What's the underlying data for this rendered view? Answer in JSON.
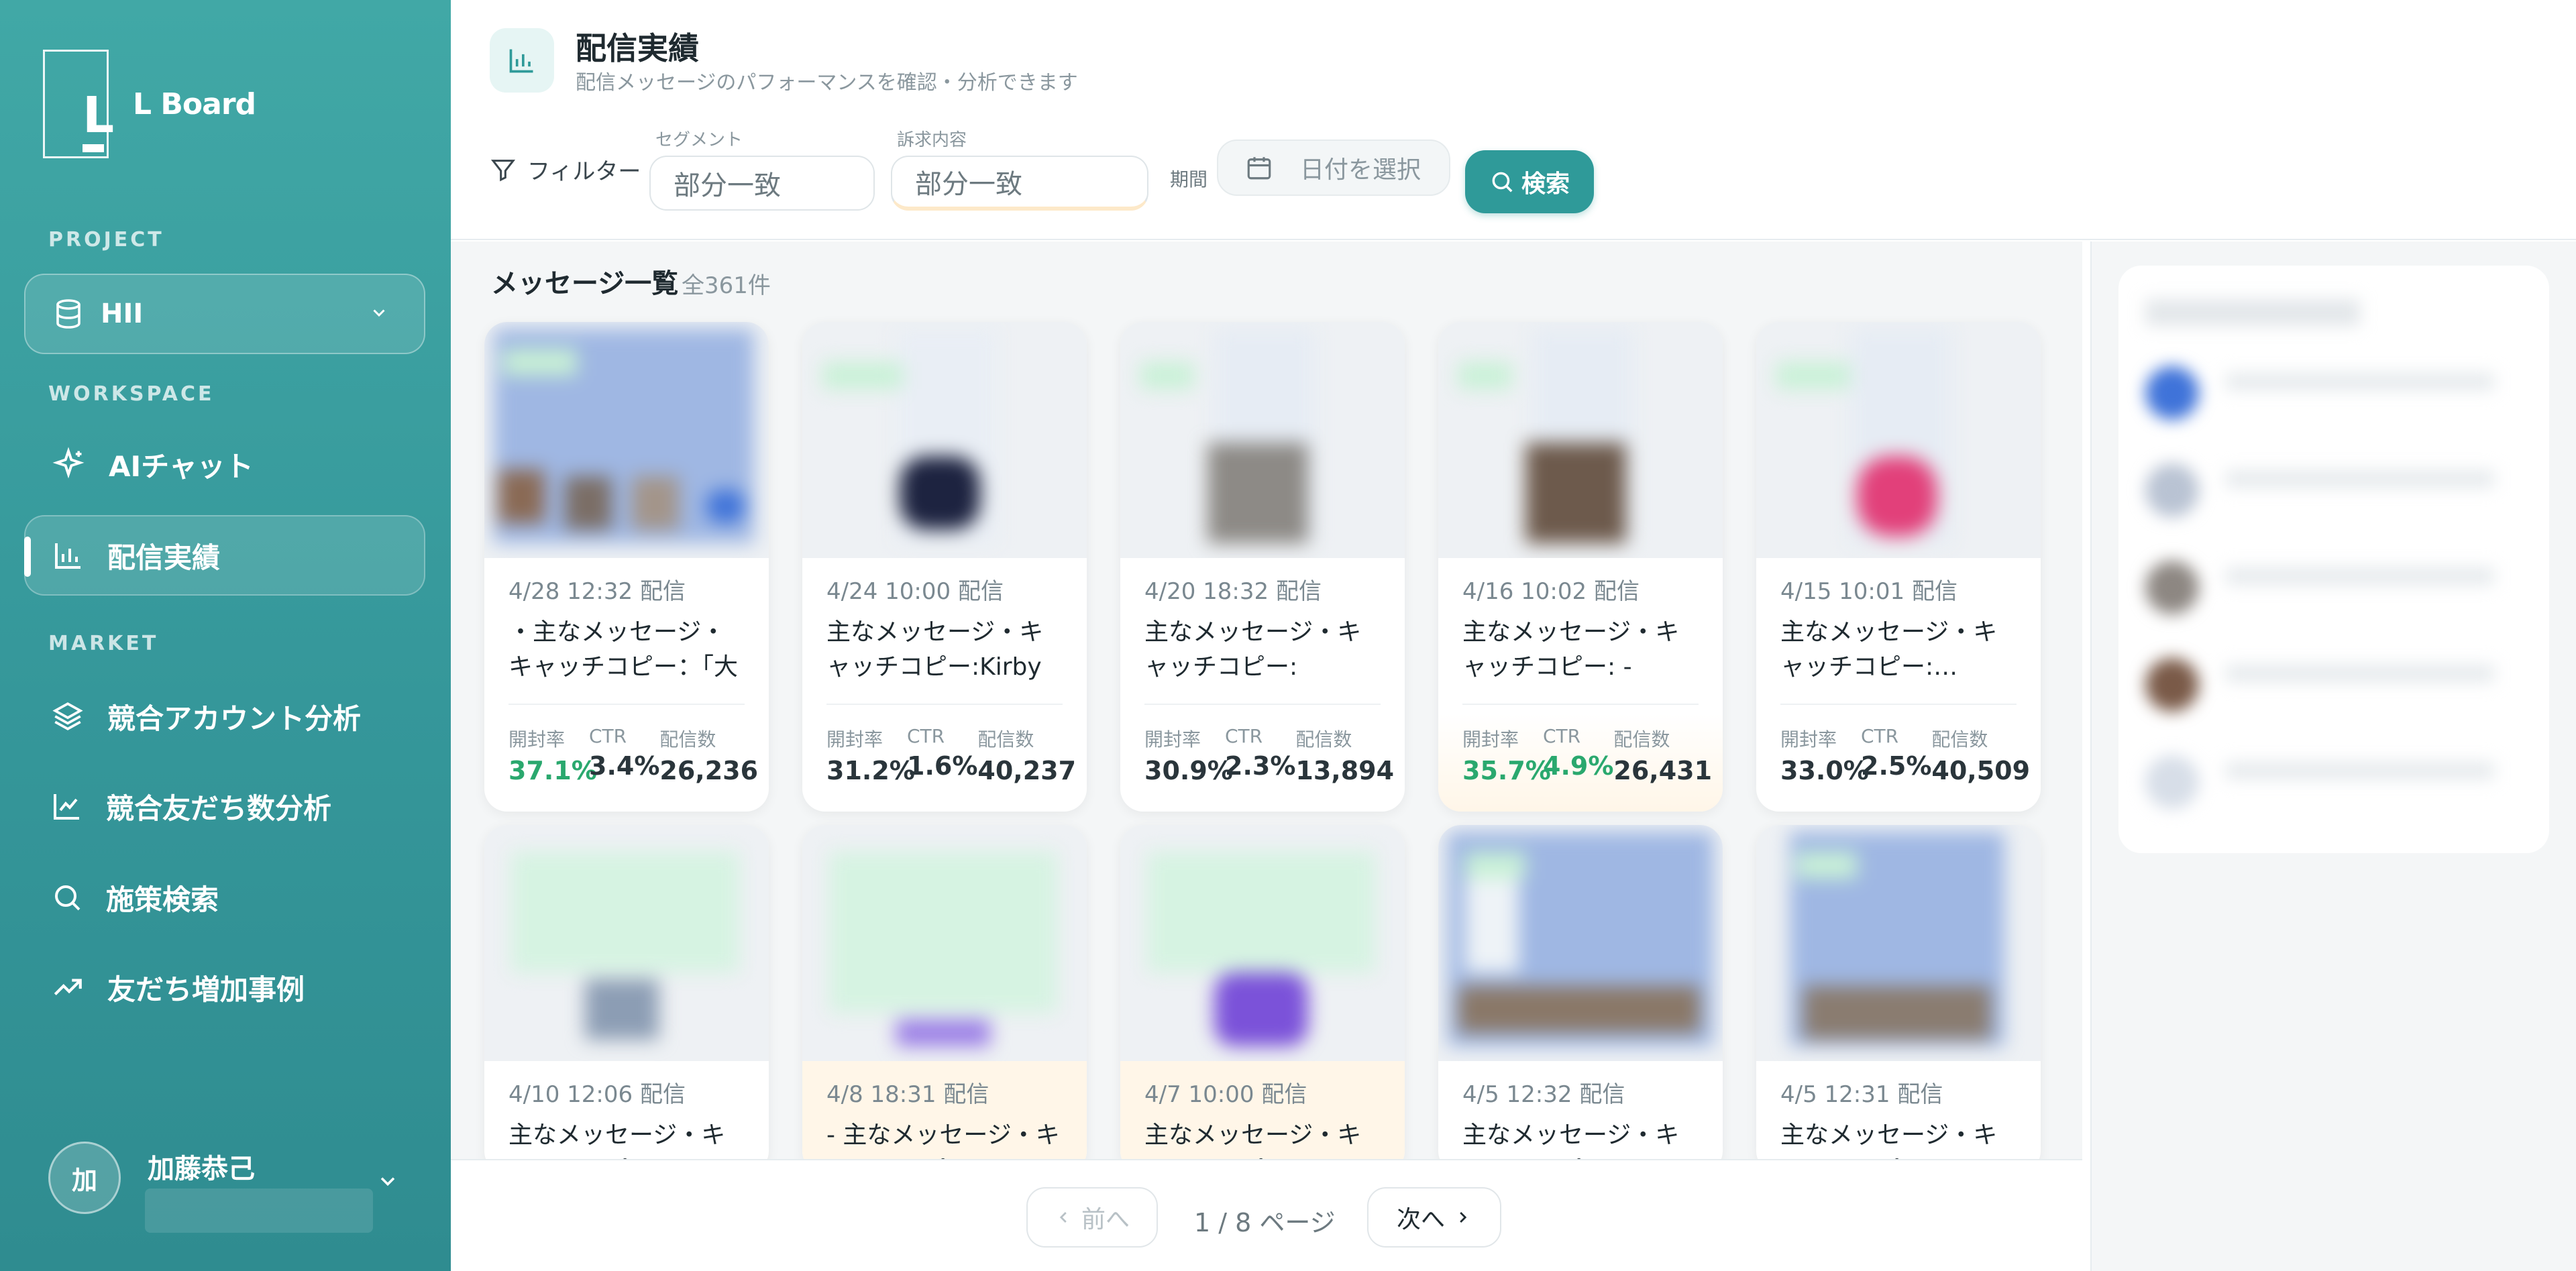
{
  "brand": {
    "name": "L Board"
  },
  "sidebar": {
    "project_label": "PROJECT",
    "project_name": "HII",
    "workspace_label": "WORKSPACE",
    "market_label": "MARKET",
    "items": [
      {
        "label": "AIチャット",
        "icon": "sparkle-icon"
      },
      {
        "label": "配信実績",
        "icon": "bar-chart-icon",
        "active": true
      },
      {
        "label": "競合アカウント分析",
        "icon": "layers-icon"
      },
      {
        "label": "競合友だち数分析",
        "icon": "line-chart-icon"
      },
      {
        "label": "施策検索",
        "icon": "search-icon"
      },
      {
        "label": "友だち増加事例",
        "icon": "trend-up-icon"
      }
    ],
    "user": {
      "initial": "加",
      "name": "加藤恭己"
    }
  },
  "header": {
    "title": "配信実績",
    "subtitle": "配信メッセージのパフォーマンスを確認・分析できます",
    "filter_label": "フィルター",
    "segment_label": "セグメント",
    "segment_value": "部分一致",
    "appeal_label": "訴求内容",
    "appeal_value": "部分一致",
    "period_label": "期間",
    "date_placeholder": "日付を選択",
    "search_label": "検索"
  },
  "list": {
    "title": "メッセージ一覧",
    "count": "全361件",
    "metric_labels": {
      "open": "開封率",
      "ctr": "CTR",
      "sent": "配信数"
    },
    "cards": [
      {
        "date": "4/28 12:32 配信",
        "copy": "・主なメッセージ・キャッチコピー：「大人…",
        "open": "37.1%",
        "ctr": "3.4%",
        "sent": "26,236"
      },
      {
        "date": "4/24 10:00 配信",
        "copy": "主なメッセージ・キャッチコピー:Kirby …",
        "open": "31.2%",
        "ctr": "1.6%",
        "sent": "40,237"
      },
      {
        "date": "4/20 18:32 配信",
        "copy": "主なメッセージ・キャッチコピー: Men'…",
        "open": "30.9%",
        "ctr": "2.3%",
        "sent": "13,894"
      },
      {
        "date": "4/16 10:02 配信",
        "copy": "主なメッセージ・キャッチコピー: -「大…",
        "open": "35.7%",
        "ctr": "4.9%",
        "sent": "26,431"
      },
      {
        "date": "4/15 10:01 配信",
        "copy": "主なメッセージ・キャッチコピー:…",
        "open": "33.0%",
        "ctr": "2.5%",
        "sent": "40,509"
      },
      {
        "date": "4/10 12:06 配信",
        "copy": "主なメッセージ・キャッチコピー…"
      },
      {
        "date": "4/8 18:31 配信",
        "copy": "- 主なメッセージ・キャッチコピー…"
      },
      {
        "date": "4/7 10:00 配信",
        "copy": "主なメッセージ・キャッチコピー…"
      },
      {
        "date": "4/5 12:32 配信",
        "copy": "主なメッセージ・キャッチコピー…"
      },
      {
        "date": "4/5 12:31 配信",
        "copy": "主なメッセージ・キャッチコピー…"
      }
    ]
  },
  "pager": {
    "prev": "前へ",
    "info": "1 / 8 ページ",
    "next": "次へ"
  },
  "colors": {
    "accent": "#2f9a99",
    "good": "#2aa86e",
    "sidebar": "#3aa0a0"
  }
}
